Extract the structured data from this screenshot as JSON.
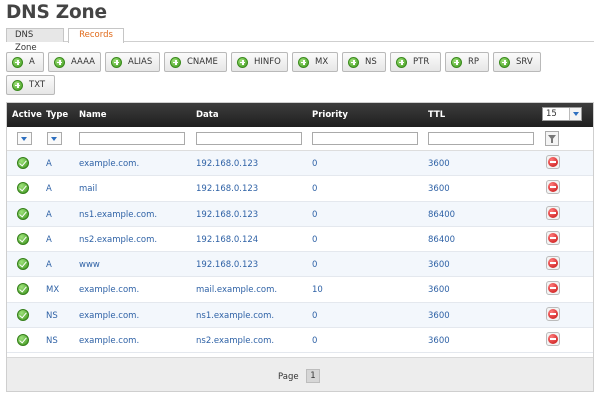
{
  "page": {
    "title": "DNS Zone"
  },
  "tabs": [
    {
      "label": "DNS Zone",
      "active": false
    },
    {
      "label": "Records",
      "active": true
    }
  ],
  "toolbar": {
    "buttons": [
      {
        "label": "A"
      },
      {
        "label": "AAAA"
      },
      {
        "label": "ALIAS"
      },
      {
        "label": "CNAME"
      },
      {
        "label": "HINFO"
      },
      {
        "label": "MX"
      },
      {
        "label": "NS"
      },
      {
        "label": "PTR"
      },
      {
        "label": "RP"
      },
      {
        "label": "SRV"
      },
      {
        "label": "TXT"
      }
    ]
  },
  "grid": {
    "headers": {
      "active": "Active",
      "type": "Type",
      "name": "Name",
      "data": "Data",
      "priority": "Priority",
      "ttl": "TTL"
    },
    "page_size": "15",
    "rows": [
      {
        "active": true,
        "type": "A",
        "name": "example.com.",
        "data": "192.168.0.123",
        "priority": "0",
        "ttl": "3600"
      },
      {
        "active": true,
        "type": "A",
        "name": "mail",
        "data": "192.168.0.123",
        "priority": "0",
        "ttl": "3600"
      },
      {
        "active": true,
        "type": "A",
        "name": "ns1.example.com.",
        "data": "192.168.0.123",
        "priority": "0",
        "ttl": "86400"
      },
      {
        "active": true,
        "type": "A",
        "name": "ns2.example.com.",
        "data": "192.168.0.124",
        "priority": "0",
        "ttl": "86400"
      },
      {
        "active": true,
        "type": "A",
        "name": "www",
        "data": "192.168.0.123",
        "priority": "0",
        "ttl": "3600"
      },
      {
        "active": true,
        "type": "MX",
        "name": "example.com.",
        "data": "mail.example.com.",
        "priority": "10",
        "ttl": "3600"
      },
      {
        "active": true,
        "type": "NS",
        "name": "example.com.",
        "data": "ns1.example.com.",
        "priority": "0",
        "ttl": "3600"
      },
      {
        "active": true,
        "type": "NS",
        "name": "example.com.",
        "data": "ns2.example.com.",
        "priority": "0",
        "ttl": "3600"
      }
    ]
  },
  "pager": {
    "label": "Page",
    "current": "1"
  },
  "colors": {
    "link": "#2f62a6",
    "tab_active": "#e06a1a",
    "header_bg": "#2b2b2b",
    "row_alt": "#f3f7fc"
  },
  "icons": {
    "add": "plus-circle-icon",
    "active": "check-circle-icon",
    "delete": "minus-circle-icon",
    "filter": "funnel-icon"
  }
}
